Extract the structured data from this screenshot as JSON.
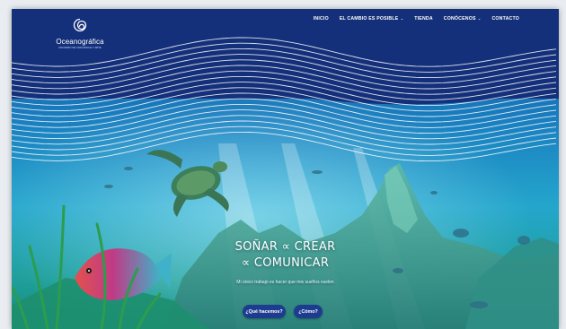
{
  "brand": {
    "name": "Oceanográfica",
    "tagline": "UNIVERSO DE CONCIENCIA Y ARTE",
    "logo_icon": "spiral-logo-icon"
  },
  "nav": {
    "items": [
      {
        "label": "INICIO",
        "has_dropdown": false
      },
      {
        "label": "EL CAMBIO ES POSIBLE",
        "has_dropdown": true
      },
      {
        "label": "TIENDA",
        "has_dropdown": false
      },
      {
        "label": "CONÓCENOS",
        "has_dropdown": true
      },
      {
        "label": "CONTACTO",
        "has_dropdown": false
      }
    ]
  },
  "hero": {
    "headline_1": "SOÑAR ∝ CREAR",
    "headline_2": "∝ COMUNICAR",
    "subtitle": "Mi único trabajo es hacer que mis sueños vuelen",
    "buttons": [
      {
        "label": "¿Qué hacemos?"
      },
      {
        "label": "¿Cómo?"
      }
    ]
  },
  "colors": {
    "header_blue": "#14307a",
    "wave_line": "#ffffff",
    "sea_top": "#1a85c4",
    "sea_bottom": "#17a6a5",
    "button": "#1d3c8f"
  }
}
